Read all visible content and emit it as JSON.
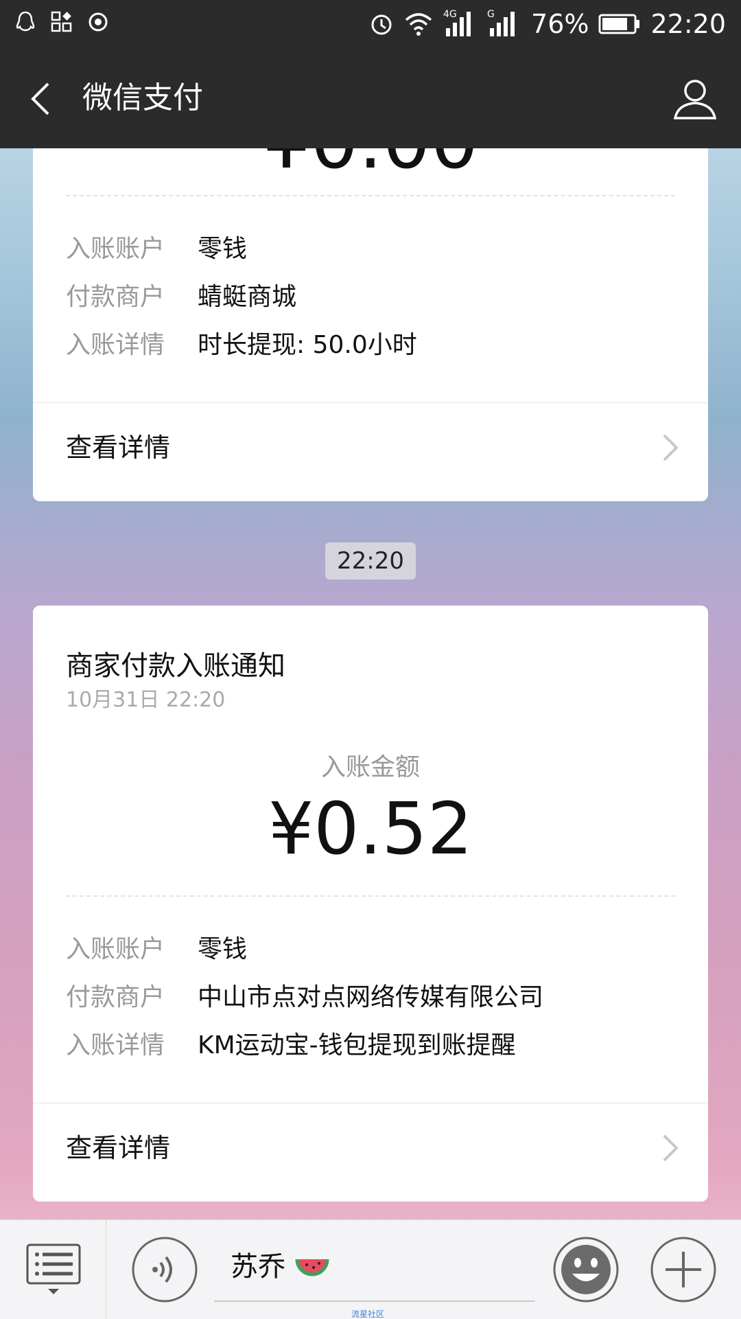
{
  "status_bar": {
    "battery": "76%",
    "time": "22:20",
    "network_1": "4G",
    "network_2": "G"
  },
  "nav": {
    "title": "微信支付"
  },
  "card1": {
    "rows": [
      {
        "label": "入账账户",
        "value": "零钱"
      },
      {
        "label": "付款商户",
        "value": "蜻蜓商城"
      },
      {
        "label": "入账详情",
        "value": "时长提现: 50.0小时"
      }
    ],
    "detail_link": "查看详情"
  },
  "time_badge": "22:20",
  "card2": {
    "title": "商家付款入账通知",
    "date": "10月31日  22:20",
    "amount_label": "入账金额",
    "amount": "¥0.52",
    "rows": [
      {
        "label": "入账账户",
        "value": "零钱"
      },
      {
        "label": "付款商户",
        "value": "中山市点对点网络传媒有限公司"
      },
      {
        "label": "入账详情",
        "value": "KM运动宝-钱包提现到账提醒"
      }
    ],
    "detail_link": "查看详情"
  },
  "bottom_bar": {
    "input_text": "苏乔",
    "watermark": "流星社区"
  },
  "colors": {
    "header_bg": "#2b2b2b",
    "card_bg": "#ffffff",
    "label_gray": "#999999"
  },
  "icons": [
    "qq-icon",
    "apps-icon",
    "record-icon",
    "alarm-icon",
    "wifi-icon",
    "signal-icon",
    "battery-icon",
    "back-arrow-icon",
    "user-icon",
    "chevron-right-icon",
    "menu-list-icon",
    "voice-icon",
    "emoji-icon",
    "plus-icon",
    "watermelon-icon"
  ]
}
